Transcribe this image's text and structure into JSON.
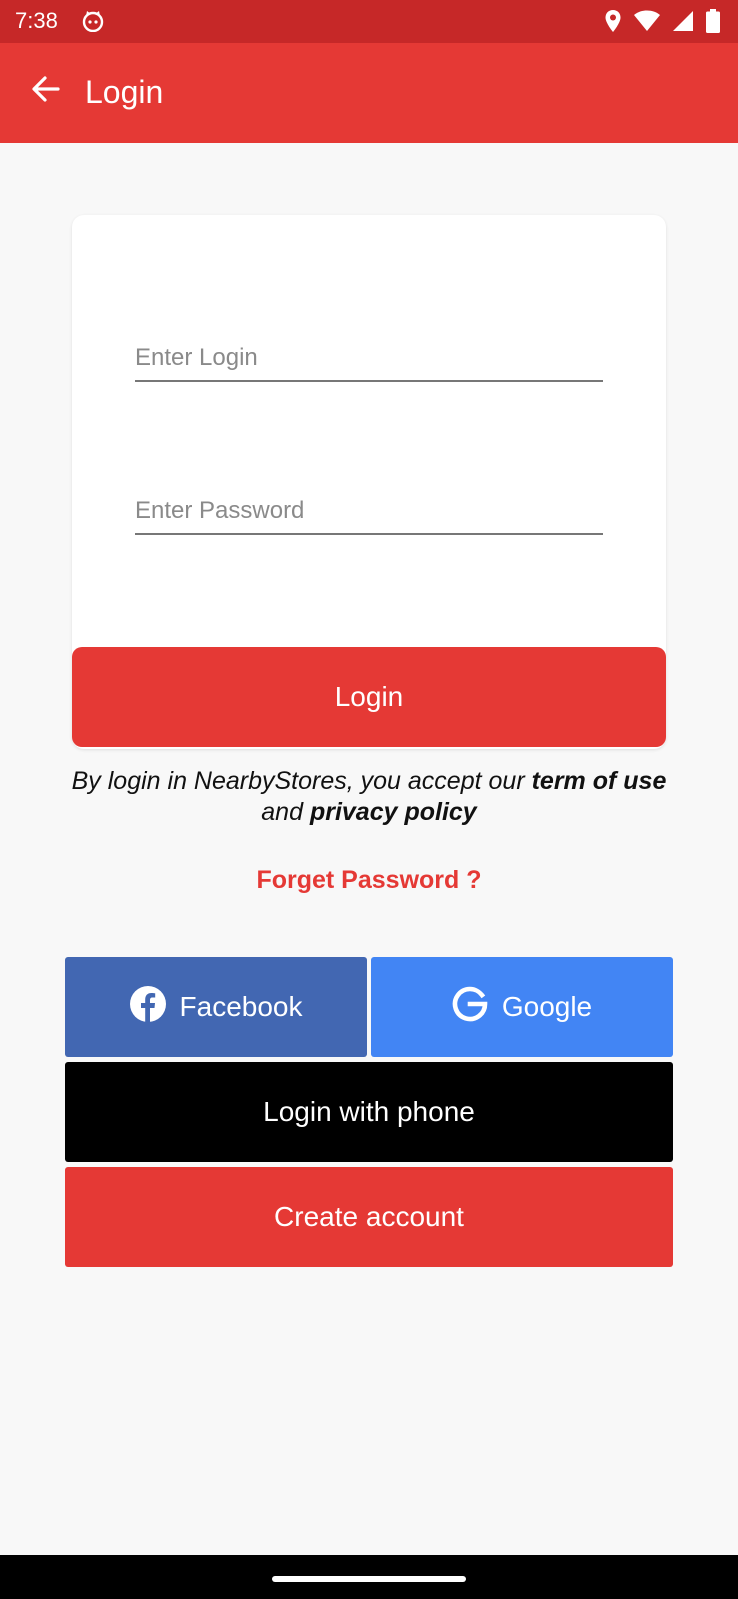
{
  "status_bar": {
    "time": "7:38",
    "icons": [
      "cat-notification-icon",
      "location-icon",
      "wifi-icon",
      "cell-signal-icon",
      "battery-icon"
    ]
  },
  "app_bar": {
    "title": "Login",
    "back_icon": "arrow-back-icon",
    "color": "#e53935"
  },
  "form": {
    "login_placeholder": "Enter Login",
    "login_value": "",
    "password_placeholder": "Enter Password",
    "password_value": "",
    "submit_label": "Login"
  },
  "terms": {
    "prefix": "By login in NearbyStores, you accept our ",
    "term_of_use": "term of use",
    "and": " and ",
    "privacy_policy": "privacy policy"
  },
  "forget_password": "Forget Password ?",
  "social": {
    "facebook_label": "Facebook",
    "facebook_color": "#4267b2",
    "google_label": "Google",
    "google_color": "#4285f4"
  },
  "phone_login_label": "Login with phone",
  "create_account_label": "Create account",
  "colors": {
    "accent": "#e53935",
    "status_bar": "#c62828",
    "background": "#f8f8f8"
  }
}
